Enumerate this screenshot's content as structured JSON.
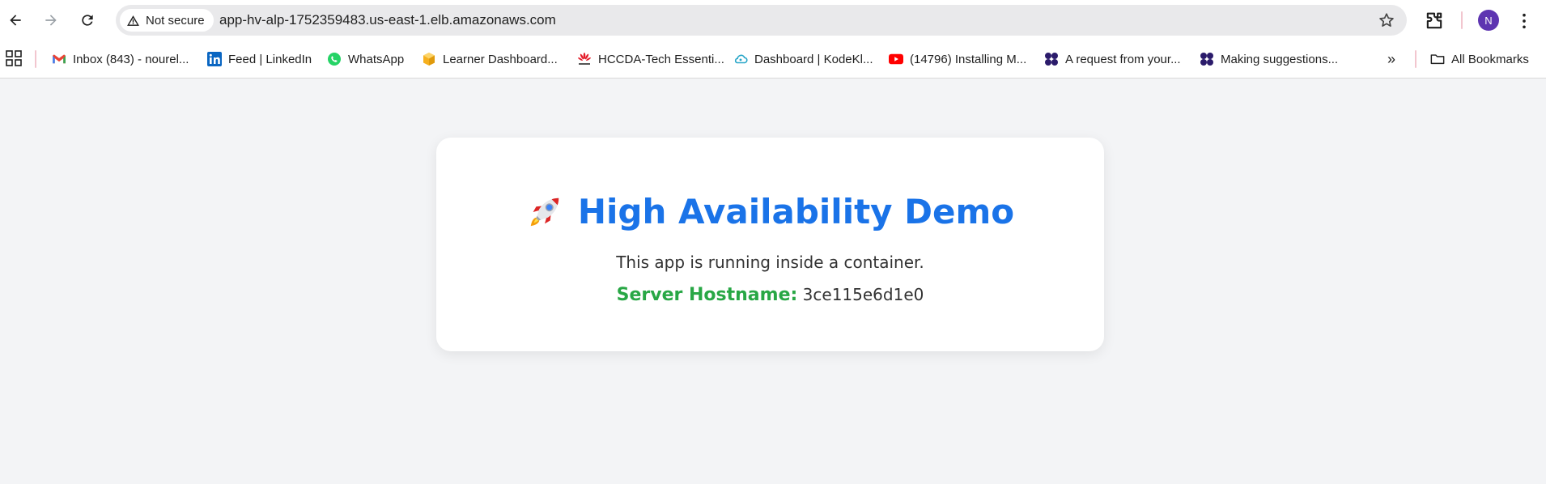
{
  "browser": {
    "security_label": "Not secure",
    "url": "app-hv-alp-1752359483.us-east-1.elb.amazonaws.com",
    "profile_initial": "N",
    "icons": [
      "back-icon",
      "forward-icon",
      "reload-icon",
      "warning-icon",
      "star-icon",
      "extensions-icon",
      "menu-icon"
    ]
  },
  "bookmarks": {
    "items": [
      {
        "label": "Inbox (843) - nourel...",
        "icon": "gmail-icon"
      },
      {
        "label": "Feed | LinkedIn",
        "icon": "linkedin-icon"
      },
      {
        "label": "WhatsApp",
        "icon": "whatsapp-icon"
      },
      {
        "label": "Learner Dashboard...",
        "icon": "box-icon"
      },
      {
        "label": "HCCDA-Tech Essenti...",
        "icon": "huawei-icon"
      },
      {
        "label": "Dashboard | KodeKl...",
        "icon": "kodekloud-icon"
      },
      {
        "label": "(14796) Installing M...",
        "icon": "youtube-icon"
      },
      {
        "label": "A request from your...",
        "icon": "dots-icon"
      },
      {
        "label": "Making suggestions...",
        "icon": "dots-icon"
      }
    ],
    "overflow_icon": "»",
    "all_bookmarks": "All Bookmarks"
  },
  "page": {
    "title": "High Availability Demo",
    "subtitle": "This app is running inside a container.",
    "hostname_label": "Server Hostname:",
    "hostname_value": "3ce115e6d1e0",
    "colors": {
      "title": "#1a73e8",
      "hostname_label": "#28a745",
      "background": "#f3f4f6"
    }
  }
}
